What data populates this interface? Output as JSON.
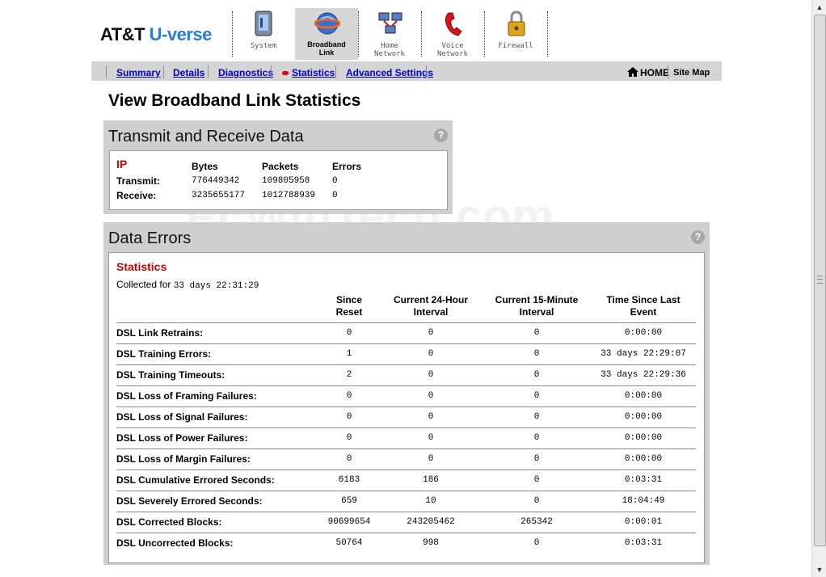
{
  "brand": {
    "att": "AT&T",
    "uverse": "U-verse"
  },
  "nav": {
    "tabs": [
      {
        "label": "System",
        "icon": "system-icon",
        "active": false
      },
      {
        "label": "Broadband\nLink",
        "icon": "broadband-globe-icon",
        "active": true
      },
      {
        "label": "Home\nNetwork",
        "icon": "home-network-icon",
        "active": false
      },
      {
        "label": "Voice\nNetwork",
        "icon": "voice-phone-icon",
        "active": false
      },
      {
        "label": "Firewall",
        "icon": "padlock-icon",
        "active": false
      }
    ]
  },
  "subnav": {
    "items": [
      "Summary",
      "Details",
      "Diagnostics",
      "Statistics",
      "Advanced Settings"
    ],
    "active": "Statistics",
    "home": "HOME",
    "sitemap": "Site Map"
  },
  "page": {
    "title": "View Broadband Link Statistics"
  },
  "watermark": "PcWinTech.com",
  "transmit": {
    "heading": "Transmit and Receive Data",
    "section": "IP",
    "columns": [
      "Bytes",
      "Packets",
      "Errors"
    ],
    "rows": [
      {
        "label": "Transmit:",
        "values": [
          "776449342",
          "109805958",
          "0"
        ]
      },
      {
        "label": "Receive:",
        "values": [
          "3235655177",
          "1012788939",
          "0"
        ]
      }
    ]
  },
  "errors": {
    "heading": "Data Errors",
    "section": "Statistics",
    "collected_label": "Collected for",
    "collected_value": "33 days 22:31:29",
    "columns": [
      "Since\nReset",
      "Current 24-Hour\nInterval",
      "Current 15-Minute\nInterval",
      "Time Since Last\nEvent"
    ],
    "rows": [
      {
        "label": "DSL Link Retrains:",
        "values": [
          "0",
          "0",
          "0",
          "0:00:00"
        ]
      },
      {
        "label": "DSL Training Errors:",
        "values": [
          "1",
          "0",
          "0",
          "33 days 22:29:07"
        ]
      },
      {
        "label": "DSL Training Timeouts:",
        "values": [
          "2",
          "0",
          "0",
          "33 days 22:29:36"
        ]
      },
      {
        "label": "DSL Loss of Framing Failures:",
        "values": [
          "0",
          "0",
          "0",
          "0:00:00"
        ]
      },
      {
        "label": "DSL Loss of Signal Failures:",
        "values": [
          "0",
          "0",
          "0",
          "0:00:00"
        ]
      },
      {
        "label": "DSL Loss of Power Failures:",
        "values": [
          "0",
          "0",
          "0",
          "0:00:00"
        ]
      },
      {
        "label": "DSL Loss of Margin Failures:",
        "values": [
          "0",
          "0",
          "0",
          "0:00:00"
        ]
      },
      {
        "label": "DSL Cumulative Errored Seconds:",
        "values": [
          "6183",
          "186",
          "0",
          "0:03:31"
        ]
      },
      {
        "label": "DSL Severely Errored Seconds:",
        "values": [
          "659",
          "10",
          "0",
          "18:04:49"
        ]
      },
      {
        "label": "DSL Corrected Blocks:",
        "values": [
          "90699654",
          "243205462",
          "265342",
          "0:00:01"
        ]
      },
      {
        "label": "DSL Uncorrected Blocks:",
        "values": [
          "50764",
          "998",
          "0",
          "0:03:31"
        ]
      }
    ]
  },
  "colors": {
    "accent_red": "#cc0000",
    "link_blue": "#0000cc",
    "brand_blue": "#2a7bd1",
    "panel_gray": "#cfcfcf"
  }
}
